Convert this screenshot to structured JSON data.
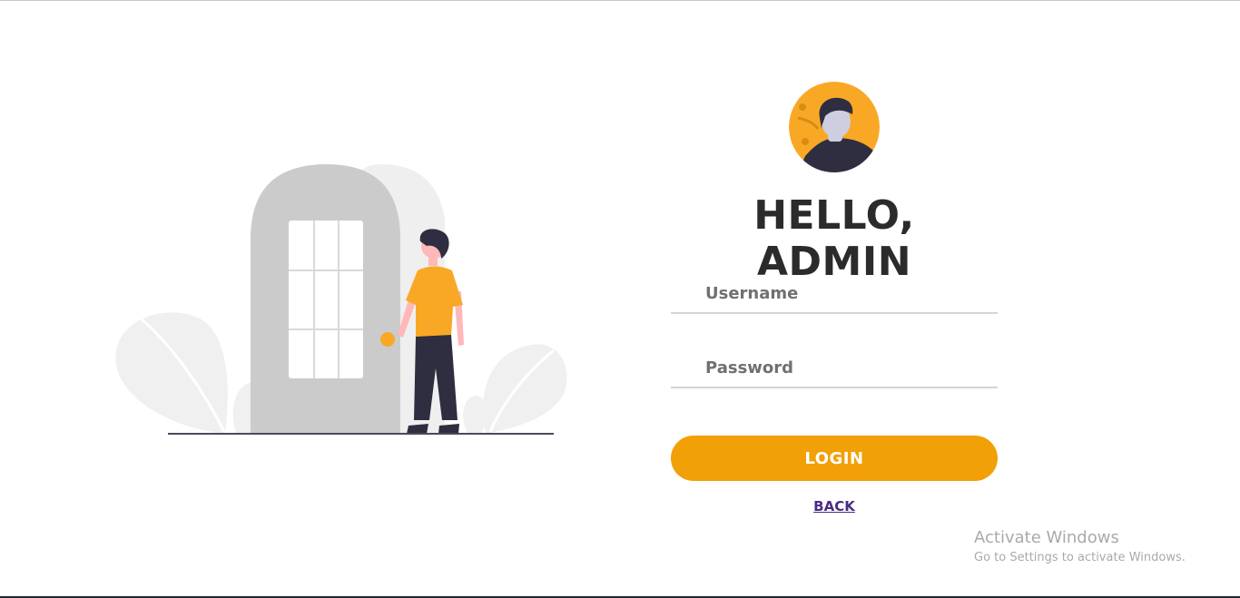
{
  "header": {
    "title": "HELLO, ADMIN"
  },
  "form": {
    "username_placeholder": "Username",
    "password_placeholder": "Password",
    "login_label": "LOGIN",
    "back_label": "BACK"
  },
  "watermark": {
    "title": "Activate Windows",
    "subtitle": "Go to Settings to activate Windows."
  },
  "icons": {
    "avatar": "user-avatar-icon",
    "illustration": "person-at-door-illustration"
  },
  "colors": {
    "accent": "#f2a007",
    "title": "#2b2b2b",
    "link": "#4b2b82",
    "underline": "#d4d4d4"
  }
}
